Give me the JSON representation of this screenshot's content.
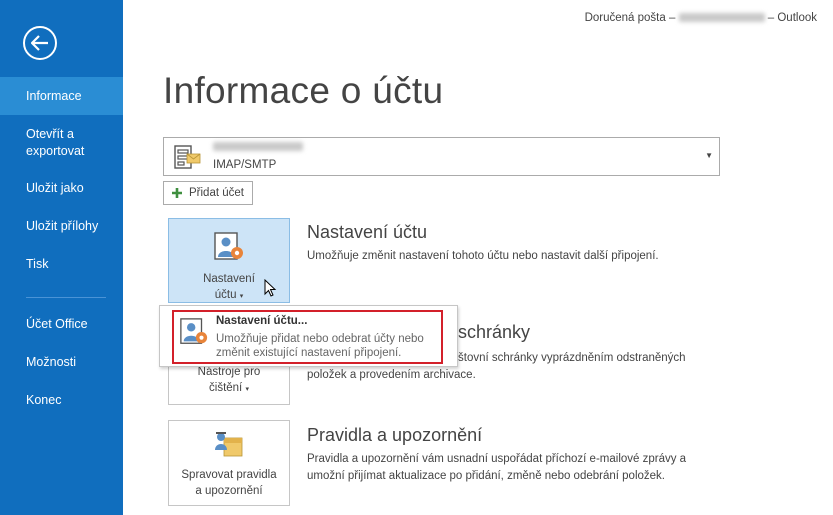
{
  "window": {
    "title_prefix": "Doručená pošta –",
    "title_suffix": "– Outlook"
  },
  "nav": {
    "items": [
      {
        "label": "Informace"
      },
      {
        "label": "Otevřít a exportovat"
      },
      {
        "label": "Uložit jako"
      },
      {
        "label": "Uložit přílohy"
      },
      {
        "label": "Tisk"
      },
      {
        "label": "Účet Office"
      },
      {
        "label": "Možnosti"
      },
      {
        "label": "Konec"
      }
    ]
  },
  "page": {
    "title": "Informace o účtu"
  },
  "account": {
    "type": "IMAP/SMTP"
  },
  "add_account": {
    "label": "Přidat účet"
  },
  "sections": {
    "account_settings": {
      "tile_label_line1": "Nastavení",
      "tile_label_line2": "účtu",
      "title": "Nastavení účtu",
      "desc": "Umožňuje změnit nastavení tohoto účtu nebo nastavit další připojení."
    },
    "cleanup": {
      "tile_label_line1": "Nástroje pro",
      "tile_label_line2": "čištění",
      "title_visible": "schránky",
      "desc_line1_visible": "štovní schránky vyprázdněním odstraněných",
      "desc_line2": "položek a provedením archivace."
    },
    "rules": {
      "tile_label_line1": "Spravovat pravidla",
      "tile_label_line2": "a upozornění",
      "title": "Pravidla a upozornění",
      "desc_line1": "Pravidla a upozornění vám usnadní uspořádat příchozí e-mailové zprávy a",
      "desc_line2": "umožní přijímat aktualizace po přidání, změně nebo odebrání položek."
    }
  },
  "popup": {
    "title": "Nastavení účtu...",
    "desc_line1": "Umožňuje přidat nebo odebrat účty nebo",
    "desc_line2": "změnit existující nastavení připojení."
  },
  "colors": {
    "nav_bg": "#106ebe",
    "nav_active": "#2a8dd4",
    "tile_selected": "#cde4f7",
    "popup_highlight_border": "#d3202a"
  }
}
